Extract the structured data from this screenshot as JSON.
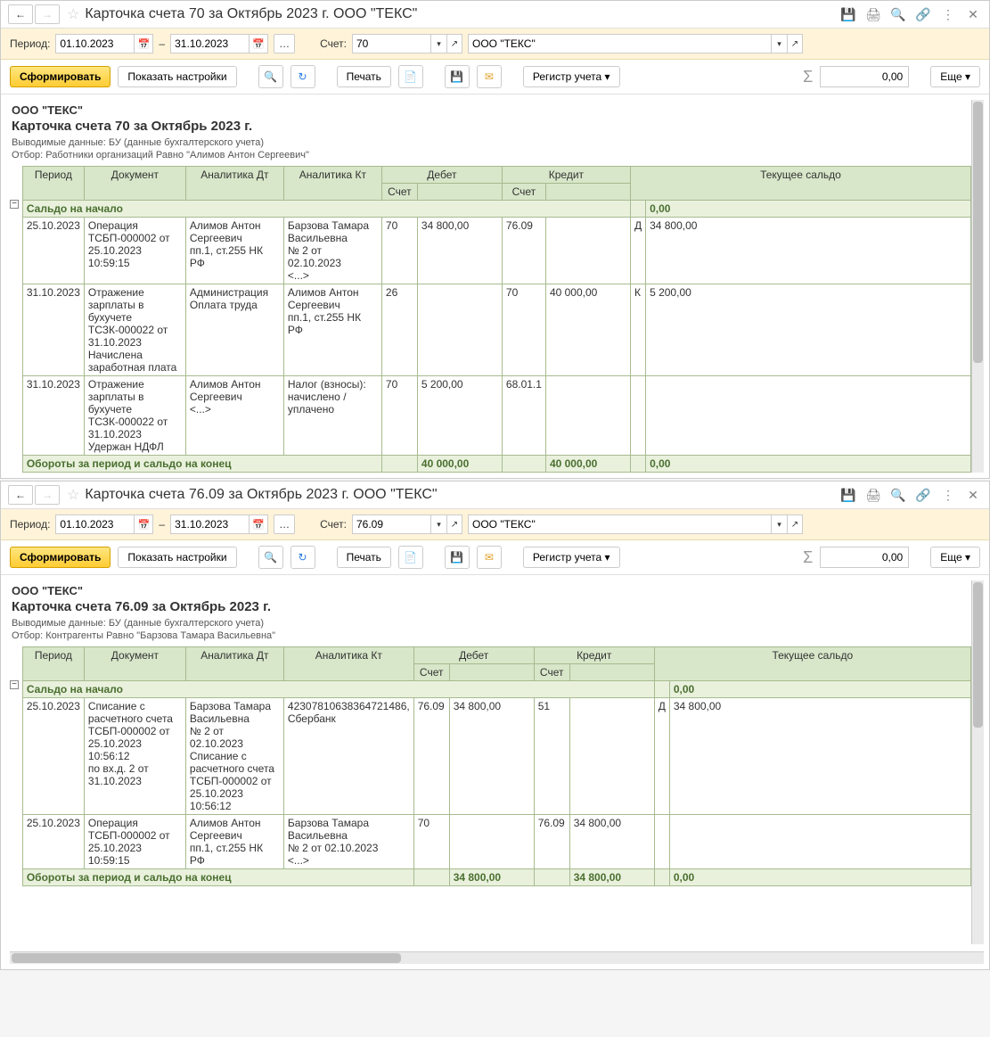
{
  "pane1": {
    "title": "Карточка счета 70 за Октябрь 2023 г. ООО \"ТЕКС\"",
    "period_label": "Период:",
    "date_from": "01.10.2023",
    "date_to": "31.10.2023",
    "dash": "–",
    "account_label": "Счет:",
    "account": "70",
    "org": "ООО \"ТЕКС\"",
    "btn_form": "Сформировать",
    "btn_settings": "Показать настройки",
    "btn_print": "Печать",
    "btn_register": "Регистр учета ▾",
    "sum_value": "0,00",
    "btn_more": "Еще ▾",
    "report": {
      "org": "ООО \"ТЕКС\"",
      "title": "Карточка счета 70 за Октябрь 2023 г.",
      "sub1": "Выводимые данные: БУ (данные бухгалтерского учета)",
      "sub2": "Отбор: Работники организаций Равно \"Алимов Антон Сергеевич\"",
      "headers": {
        "period": "Период",
        "document": "Документ",
        "an_dt": "Аналитика Дт",
        "an_kt": "Аналитика Кт",
        "debit": "Дебет",
        "credit": "Кредит",
        "saldo": "Текущее сальдо",
        "acc": "Счет"
      },
      "opening": {
        "label": "Сальдо на начало",
        "value": "0,00"
      },
      "rows": [
        {
          "period": "25.10.2023",
          "document": "Операция ТСБП-000002 от 25.10.2023 10:59:15",
          "an_dt": "Алимов Антон Сергеевич\nпп.1, ст.255 НК РФ",
          "an_kt": "Барзова Тамара Васильевна\n№ 2 от 02.10.2023\n<...>",
          "dt_acc": "70",
          "dt_sum": "34 800,00",
          "kt_acc": "76.09",
          "kt_sum": "",
          "saldo_sign": "Д",
          "saldo": "34 800,00"
        },
        {
          "period": "31.10.2023",
          "document": "Отражение зарплаты в бухучете ТСЗК-000022 от 31.10.2023\nНачислена заработная плата",
          "an_dt": "Администрация\nОплата труда",
          "an_kt": "Алимов Антон Сергеевич\nпп.1, ст.255 НК РФ",
          "dt_acc": "26",
          "dt_sum": "",
          "kt_acc": "70",
          "kt_sum": "40 000,00",
          "saldo_sign": "К",
          "saldo": "5 200,00"
        },
        {
          "period": "31.10.2023",
          "document": "Отражение зарплаты в бухучете ТСЗК-000022 от 31.10.2023\nУдержан НДФЛ",
          "an_dt": "Алимов Антон Сергеевич\n<...>",
          "an_kt": "Налог (взносы): начислено / уплачено",
          "dt_acc": "70",
          "dt_sum": "5 200,00",
          "kt_acc": "68.01.1",
          "kt_sum": "",
          "saldo_sign": "",
          "saldo": ""
        }
      ],
      "closing": {
        "label": "Обороты за период и сальдо на конец",
        "dt": "40 000,00",
        "kt": "40 000,00",
        "saldo": "0,00"
      }
    }
  },
  "pane2": {
    "title": "Карточка счета 76.09 за Октябрь 2023 г. ООО \"ТЕКС\"",
    "period_label": "Период:",
    "date_from": "01.10.2023",
    "date_to": "31.10.2023",
    "dash": "–",
    "account_label": "Счет:",
    "account": "76.09",
    "org": "ООО \"ТЕКС\"",
    "btn_form": "Сформировать",
    "btn_settings": "Показать настройки",
    "btn_print": "Печать",
    "btn_register": "Регистр учета ▾",
    "sum_value": "0,00",
    "btn_more": "Еще ▾",
    "report": {
      "org": "ООО \"ТЕКС\"",
      "title": "Карточка счета 76.09 за Октябрь 2023 г.",
      "sub1": "Выводимые данные: БУ (данные бухгалтерского учета)",
      "sub2": "Отбор: Контрагенты Равно \"Барзова Тамара Васильевна\"",
      "headers": {
        "period": "Период",
        "document": "Документ",
        "an_dt": "Аналитика Дт",
        "an_kt": "Аналитика Кт",
        "debit": "Дебет",
        "credit": "Кредит",
        "saldo": "Текущее сальдо",
        "acc": "Счет"
      },
      "opening": {
        "label": "Сальдо на начало",
        "value": "0,00"
      },
      "rows": [
        {
          "period": "25.10.2023",
          "document": "Списание с расчетного счета ТСБП-000002 от 25.10.2023 10:56:12\n по вх.д. 2 от 31.10.2023",
          "an_dt": "Барзова Тамара Васильевна\n№ 2 от 02.10.2023\nСписание с расчетного счета ТСБП-000002 от 25.10.2023 10:56:12",
          "an_kt": "42307810638364721486, Сбербанк",
          "dt_acc": "76.09",
          "dt_sum": "34 800,00",
          "kt_acc": "51",
          "kt_sum": "",
          "saldo_sign": "Д",
          "saldo": "34 800,00"
        },
        {
          "period": "25.10.2023",
          "document": "Операция ТСБП-000002 от 25.10.2023 10:59:15",
          "an_dt": "Алимов Антон Сергеевич\nпп.1, ст.255 НК РФ",
          "an_kt": "Барзова Тамара Васильевна\n№ 2 от 02.10.2023\n<...>",
          "dt_acc": "70",
          "dt_sum": "",
          "kt_acc": "76.09",
          "kt_sum": "34 800,00",
          "saldo_sign": "",
          "saldo": ""
        }
      ],
      "closing": {
        "label": "Обороты за период и сальдо на конец",
        "dt": "34 800,00",
        "kt": "34 800,00",
        "saldo": "0,00"
      }
    }
  }
}
